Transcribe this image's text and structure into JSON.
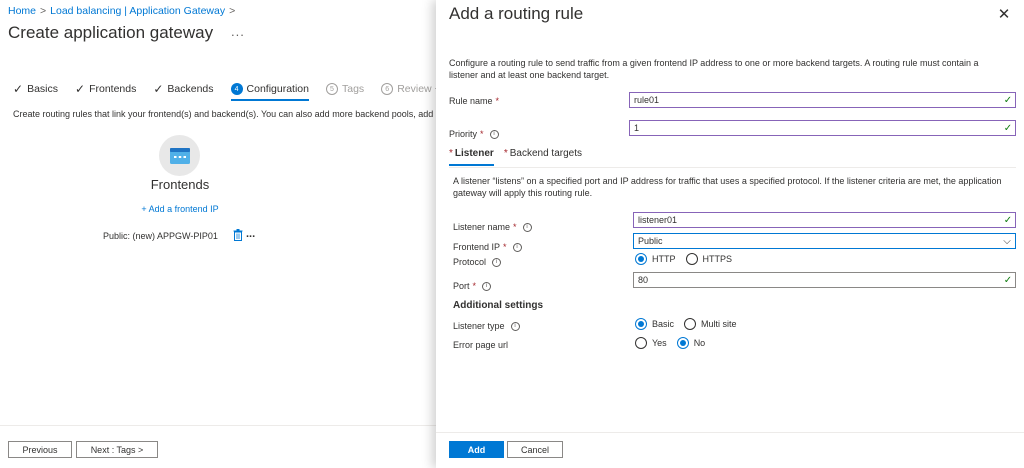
{
  "breadcrumb": {
    "items": [
      "Home",
      "Load balancing | Application Gateway"
    ],
    "trailing": ">"
  },
  "page": {
    "title": "Create application gateway",
    "more": "..."
  },
  "steps": [
    {
      "label": "Basics",
      "state": "done"
    },
    {
      "label": "Frontends",
      "state": "done"
    },
    {
      "label": "Backends",
      "state": "done"
    },
    {
      "label": "Configuration",
      "number": "4",
      "state": "active"
    },
    {
      "label": "Tags",
      "number": "5",
      "state": "disabled"
    },
    {
      "label": "Review + cre",
      "number": "6",
      "state": "disabled"
    }
  ],
  "configuration": {
    "description": "Create routing rules that link your frontend(s) and backend(s). You can also add more backend pools, add",
    "frontends": {
      "title": "Frontends",
      "add_link": "+ Add a frontend IP",
      "item": "Public: (new) APPGW-PIP01",
      "more": "..."
    }
  },
  "left_footer": {
    "previous": "Previous",
    "next": "Next : Tags >"
  },
  "panel": {
    "title": "Add a routing rule",
    "close": "✕",
    "intro": "Configure a routing rule to send traffic from a given frontend IP address to one or more backend targets. A routing rule must contain a listener and at least one backend target.",
    "rule_name": {
      "label": "Rule name",
      "required": "*",
      "value": "rule01"
    },
    "priority": {
      "label": "Priority",
      "required": "*",
      "value": "1"
    },
    "tabs": [
      {
        "star": "*",
        "label": "Listener",
        "active": true
      },
      {
        "star": "*",
        "label": "Backend targets",
        "active": false
      }
    ],
    "listener": {
      "intro": "A listener “listens” on a specified port and IP address for traffic that uses a specified protocol. If the listener criteria are met, the application gateway will apply this routing rule.",
      "name": {
        "label": "Listener name",
        "required": "*",
        "value": "listener01"
      },
      "frontend_ip": {
        "label": "Frontend IP",
        "required": "*",
        "value": "Public"
      },
      "protocol": {
        "label": "Protocol",
        "options": [
          "HTTP",
          "HTTPS"
        ],
        "selected": "HTTP"
      },
      "port": {
        "label": "Port",
        "required": "*",
        "value": "80"
      },
      "additional_settings": "Additional settings",
      "listener_type": {
        "label": "Listener type",
        "options": [
          "Basic",
          "Multi site"
        ],
        "selected": "Basic"
      },
      "error_page_url": {
        "label": "Error page url",
        "options": [
          "Yes",
          "No"
        ],
        "selected": "No"
      }
    },
    "footer": {
      "add": "Add",
      "cancel": "Cancel"
    }
  },
  "colors": {
    "accent": "#0078d4",
    "valid": "#107c10",
    "focus_border": "#8764b8",
    "required": "#a4262c"
  }
}
